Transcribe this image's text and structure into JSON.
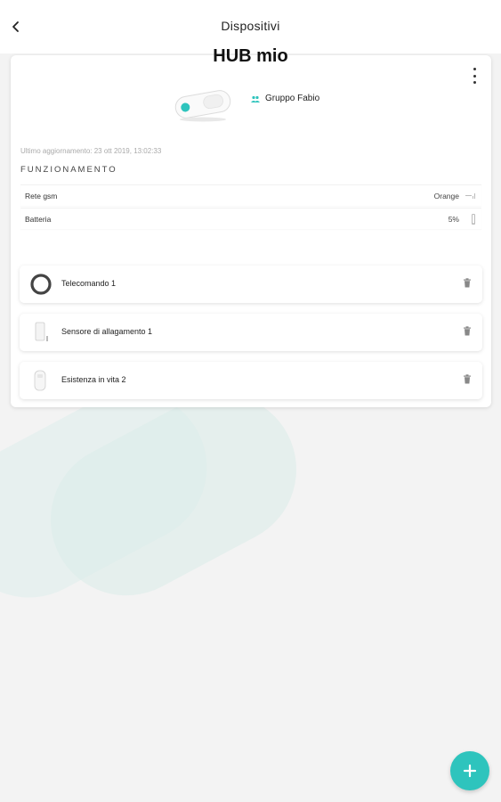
{
  "header": {
    "title": "Dispositivi",
    "back_icon": "chevron-left-icon"
  },
  "hub": {
    "name": "HUB mio",
    "group_label": "Gruppo Fabio",
    "group_icon": "group-people-icon",
    "last_update": "Ultimo aggiornamento: 23 ott 2019, 13:02:33",
    "section_title": "FUNZIONAMENTO",
    "rows": [
      {
        "label": "Rete gsm",
        "value": "Orange",
        "icon": "signal-icon"
      },
      {
        "label": "Batteria",
        "value": "5%",
        "icon": "battery-icon",
        "level": 0.05
      }
    ]
  },
  "devices": [
    {
      "name": "Telecomando 1",
      "icon": "remote-ring-icon"
    },
    {
      "name": "Sensore di allagamento 1",
      "icon": "flood-sensor-icon"
    },
    {
      "name": "Esistenza in vita 2",
      "icon": "wearable-sensor-icon"
    }
  ],
  "colors": {
    "accent": "#2ec4bd",
    "background": "#f3f3f3",
    "card": "#ffffff"
  },
  "fab": {
    "icon": "plus-icon"
  }
}
